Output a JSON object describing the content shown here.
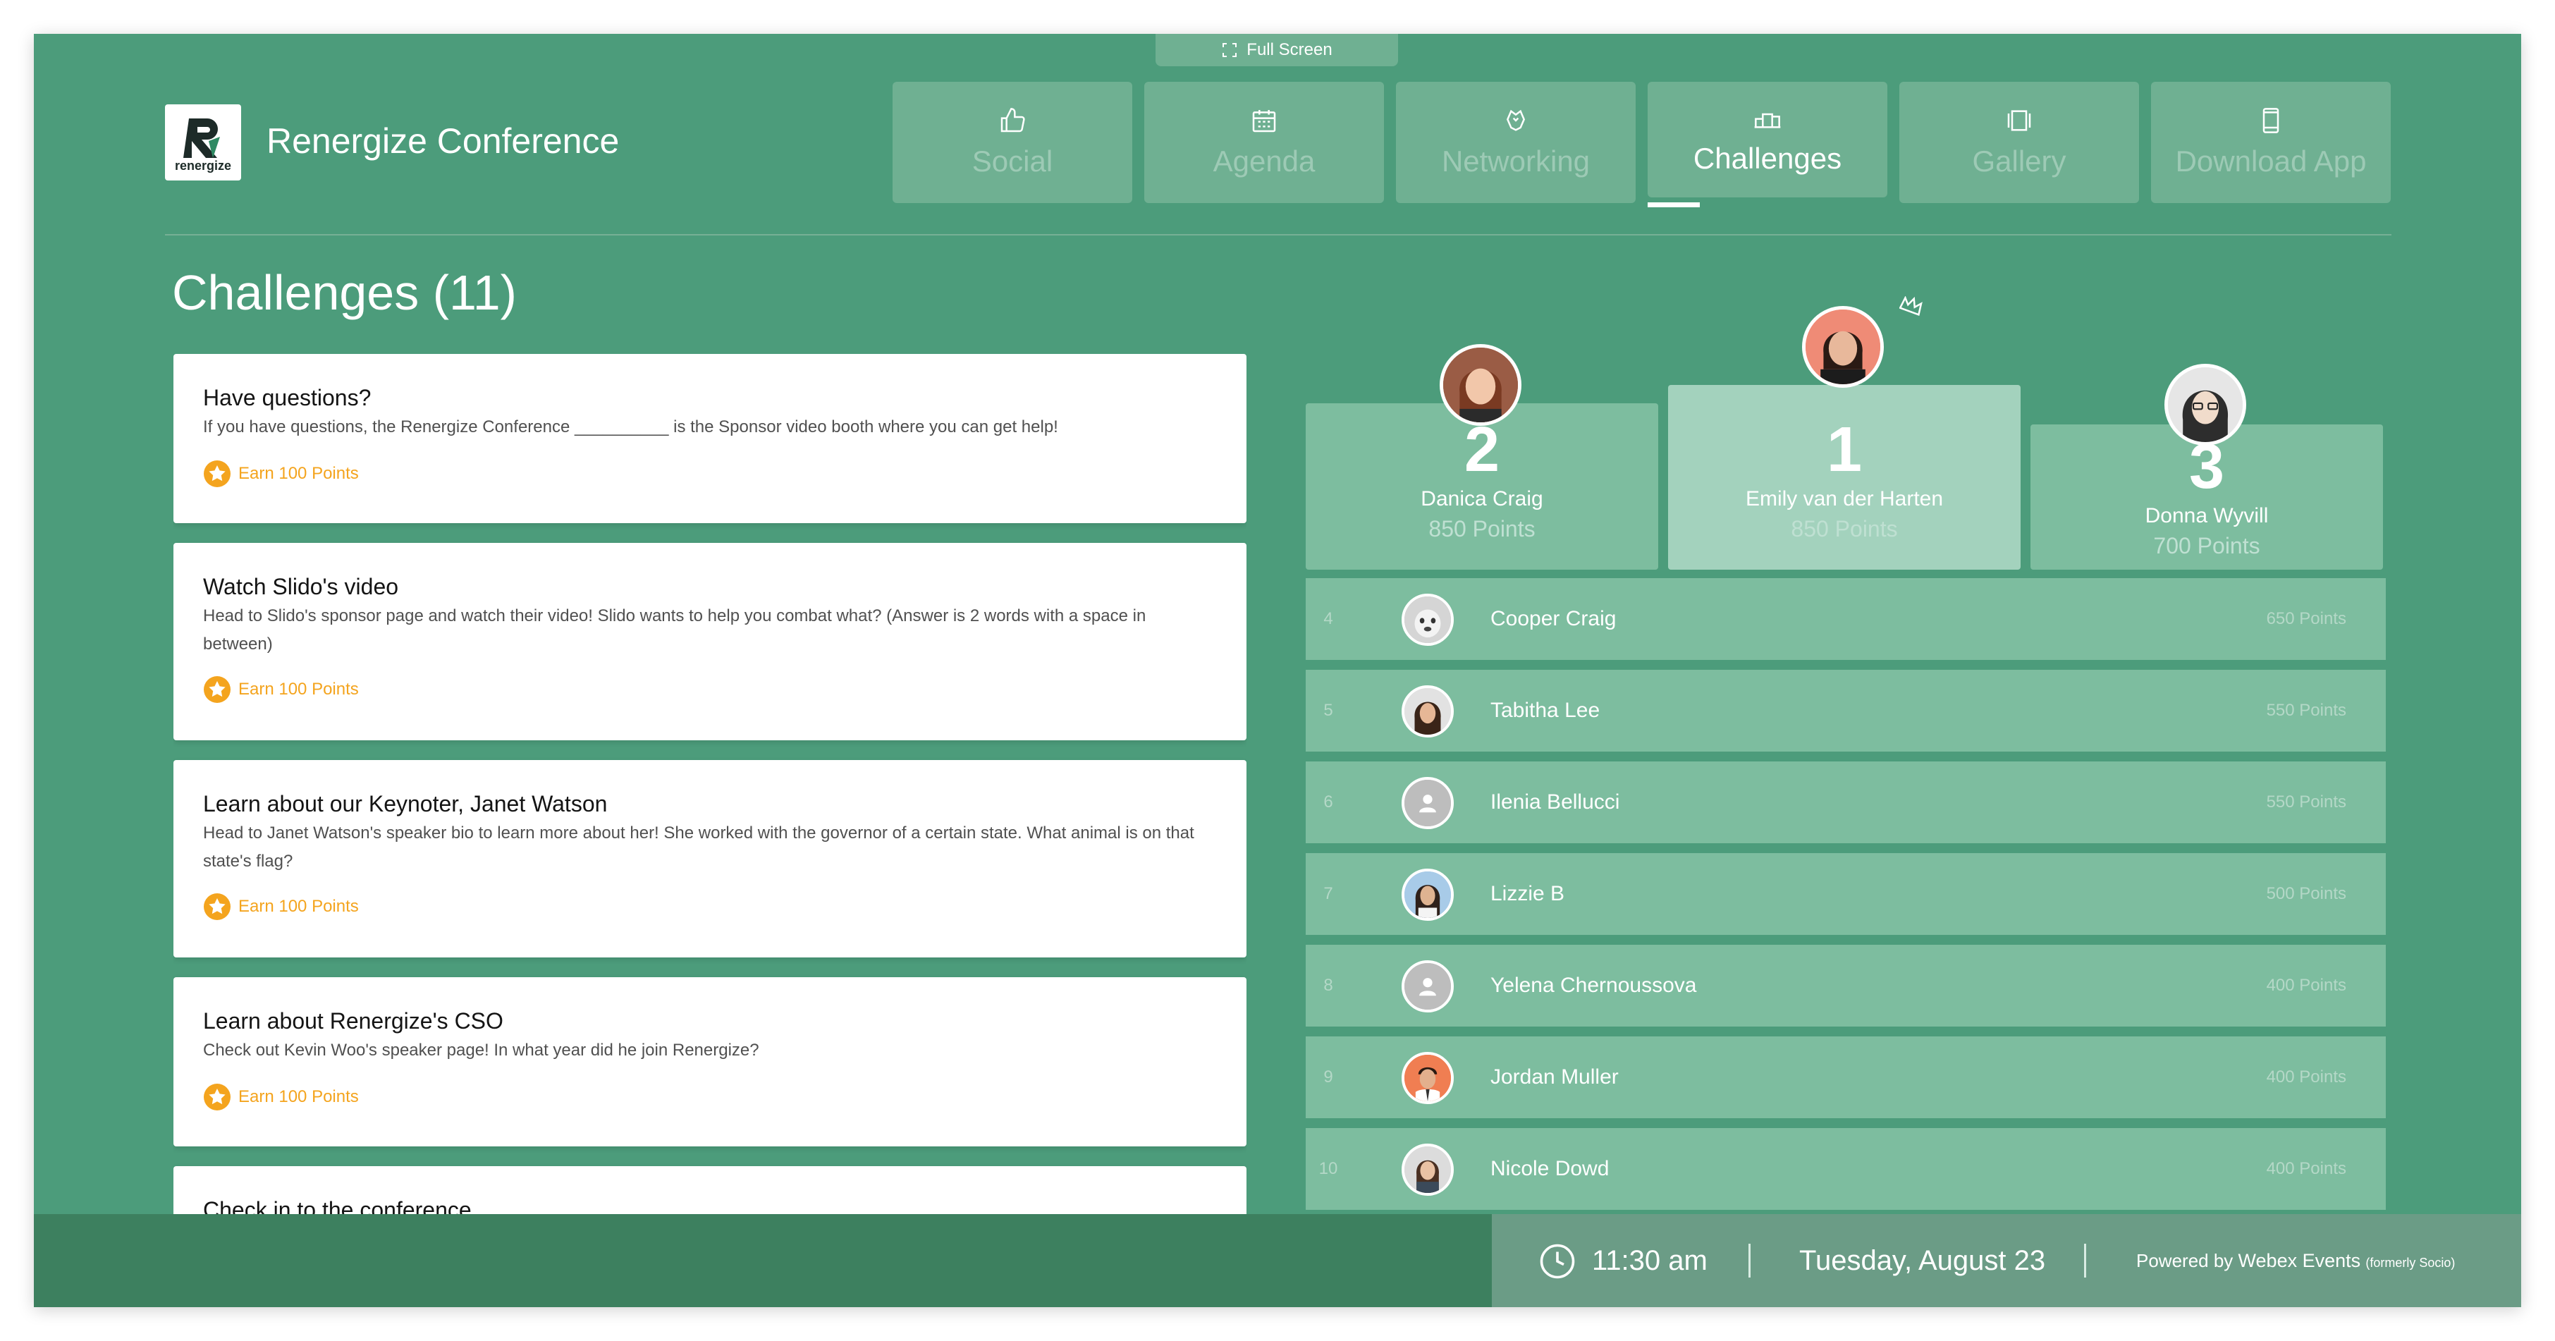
{
  "fullscreen": {
    "label": "Full Screen"
  },
  "header": {
    "logo_text": "renergize",
    "title": "Renergize Conference"
  },
  "nav": {
    "tabs": [
      {
        "label": "Social",
        "icon": "thumbs-up-icon"
      },
      {
        "label": "Agenda",
        "icon": "calendar-icon"
      },
      {
        "label": "Networking",
        "icon": "networking-icon"
      },
      {
        "label": "Challenges",
        "icon": "podium-icon",
        "active": true
      },
      {
        "label": "Gallery",
        "icon": "gallery-icon"
      },
      {
        "label": "Download App",
        "icon": "phone-icon"
      }
    ]
  },
  "challenges": {
    "heading": "Challenges (11)",
    "items": [
      {
        "title": "Have questions?",
        "description": "If you have questions, the Renergize Conference __________ is the Sponsor video booth where you can get help!",
        "reward": "Earn 100 Points"
      },
      {
        "title": "Watch Slido's video",
        "description": "Head to Slido's sponsor page and watch their video! Slido wants to help you combat what? (Answer is 2 words with a space in between)",
        "reward": "Earn 100 Points"
      },
      {
        "title": "Learn about our Keynoter, Janet Watson",
        "description": "Head to Janet Watson's speaker bio to learn more about her! She worked with the governor of a certain state. What animal is on that state's flag?",
        "reward": "Earn 100 Points"
      },
      {
        "title": "Learn about Renergize's CSO",
        "description": "Check out Kevin Woo's speaker page! In what year did he join Renergize?",
        "reward": "Earn 100 Points"
      },
      {
        "title": "Check in to the conference",
        "description": "",
        "reward": ""
      }
    ]
  },
  "podium": {
    "first": {
      "rank": "1",
      "name": "Emily van der Harten",
      "points": "850 Points"
    },
    "second": {
      "rank": "2",
      "name": "Danica Craig",
      "points": "850 Points"
    },
    "third": {
      "rank": "3",
      "name": "Donna Wyvill",
      "points": "700 Points"
    }
  },
  "leaderboard": [
    {
      "rank": "4",
      "name": "Cooper Craig",
      "points": "650 Points"
    },
    {
      "rank": "5",
      "name": "Tabitha Lee",
      "points": "550 Points"
    },
    {
      "rank": "6",
      "name": "Ilenia Bellucci",
      "points": "550 Points"
    },
    {
      "rank": "7",
      "name": "Lizzie B",
      "points": "500 Points"
    },
    {
      "rank": "8",
      "name": "Yelena Chernoussova",
      "points": "400 Points"
    },
    {
      "rank": "9",
      "name": "Jordan Muller",
      "points": "400 Points"
    },
    {
      "rank": "10",
      "name": "Nicole Dowd",
      "points": "400 Points"
    }
  ],
  "footer": {
    "time": "11:30 am",
    "date": "Tuesday, August 23",
    "powered_prefix": "Powered by",
    "powered_brand": "Webex Events",
    "powered_suffix": "(formerly Socio)"
  },
  "colors": {
    "background": "#4c9c7b",
    "tab": "#6fb092",
    "reward": "#f4a41e",
    "footer": "#3d805f"
  }
}
